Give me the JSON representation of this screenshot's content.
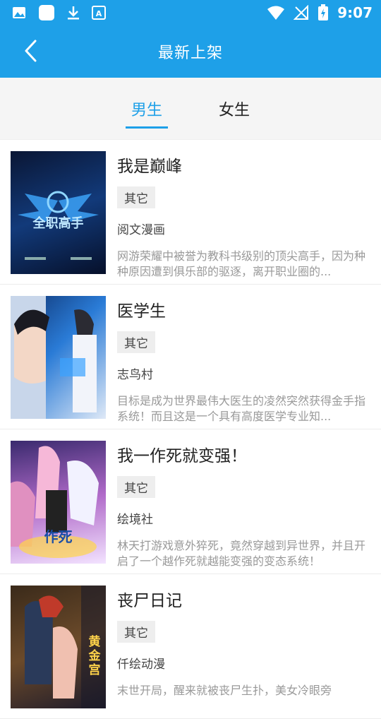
{
  "status_bar": {
    "time": "9:07"
  },
  "app_bar": {
    "title": "最新上架"
  },
  "tabs": [
    {
      "label": "男生",
      "active": true
    },
    {
      "label": "女生",
      "active": false
    }
  ],
  "books": [
    {
      "title": "我是巅峰",
      "tag": "其它",
      "author": "阅文漫画",
      "desc": "网游荣耀中被誉为教科书级别的顶尖高手，因为种种原因遭到俱乐部的驱逐，离开职业圈的...",
      "cover_text": "全职高手"
    },
    {
      "title": "医学生",
      "tag": "其它",
      "author": "志鸟村",
      "desc": "目标是成为世界最伟大医生的凌然突然获得金手指系统！而且这是一个具有高度医学专业知...",
      "cover_text": ""
    },
    {
      "title": "我一作死就变强！",
      "tag": "其它",
      "author": "绘境社",
      "desc": "林天打游戏意外猝死，竟然穿越到异世界，并且开启了一个越作死就越能变强的变态系统！",
      "cover_text": "作死"
    },
    {
      "title": "丧尸日记",
      "tag": "其它",
      "author": "仟绘动漫",
      "desc": "末世开局，醒来就被丧尸生扑，美女冷眼旁",
      "cover_text": "黄金宫"
    }
  ]
}
